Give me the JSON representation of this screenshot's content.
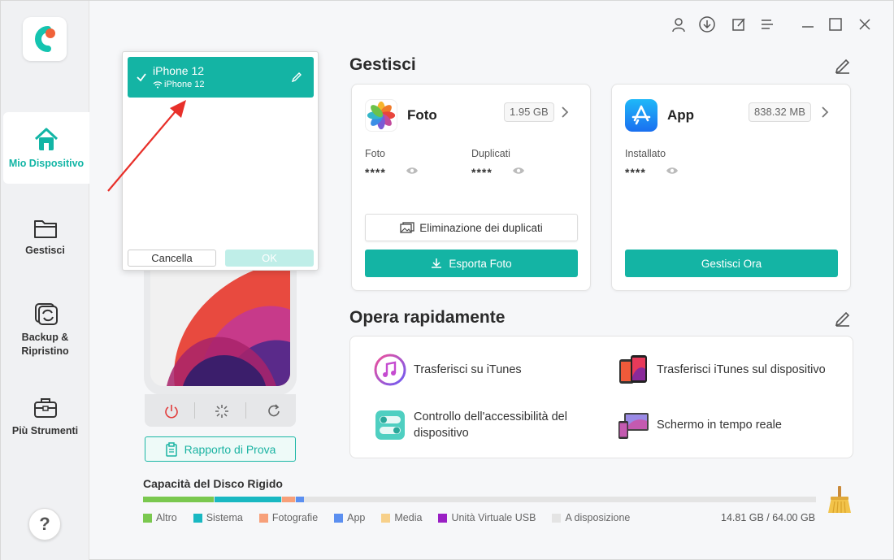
{
  "sidebar": {
    "items": [
      {
        "label": "Mio Dispositivo",
        "icon": "home-icon",
        "active": true
      },
      {
        "label": "Gestisci",
        "icon": "folder-icon"
      },
      {
        "label": "Backup & Ripristino",
        "icon": "backup-icon"
      },
      {
        "label": "Più Strumenti",
        "icon": "toolbox-icon"
      }
    ],
    "help_label": "?"
  },
  "device_popup": {
    "device_name": "iPhone 12",
    "connection_name": "iPhone 12",
    "cancel_label": "Cancella",
    "ok_label": "OK"
  },
  "device": {
    "report_label": "Rapporto di Prova"
  },
  "manage": {
    "title": "Gestisci",
    "photos": {
      "title": "Foto",
      "size": "1.95 GB",
      "stat1_label": "Foto",
      "stat1_value": "****",
      "stat2_label": "Duplicati",
      "stat2_value": "****",
      "dedupe_label": "Eliminazione dei duplicati",
      "export_label": "Esporta Foto"
    },
    "apps": {
      "title": "App",
      "size": "838.32 MB",
      "stat1_label": "Installato",
      "stat1_value": "****",
      "manage_label": "Gestisci Ora"
    }
  },
  "quick": {
    "title": "Opera rapidamente",
    "items": [
      {
        "label": "Trasferisci su iTunes",
        "icon": "itunes-icon"
      },
      {
        "label": "Trasferisci iTunes sul dispositivo",
        "icon": "phone-transfer-icon"
      },
      {
        "label": "Controllo dell'accessibilità del dispositivo",
        "icon": "toggle-icon"
      },
      {
        "label": "Schermo in tempo reale",
        "icon": "screen-mirror-icon"
      }
    ]
  },
  "disk": {
    "title": "Capacità del Disco Rigido",
    "legend": [
      {
        "label": "Altro",
        "color": "#7ac84f"
      },
      {
        "label": "Sistema",
        "color": "#19b8c2"
      },
      {
        "label": "Fotografie",
        "color": "#f7a07a"
      },
      {
        "label": "App",
        "color": "#5b8ff0"
      },
      {
        "label": "Media",
        "color": "#f7d08a"
      },
      {
        "label": "Unità Virtuale USB",
        "color": "#9a1fc4"
      },
      {
        "label": "A disposizione",
        "color": "#e4e4e4"
      }
    ],
    "usage_fractions": {
      "Altro": 0.105,
      "Sistema": 0.099,
      "Fotografie": 0.019,
      "App": 0.013,
      "Media": 0.0,
      "Unità Virtuale USB": 0.0
    },
    "total_label": "14.81 GB / 64.00 GB"
  },
  "colors": {
    "accent": "#14b4a4"
  }
}
